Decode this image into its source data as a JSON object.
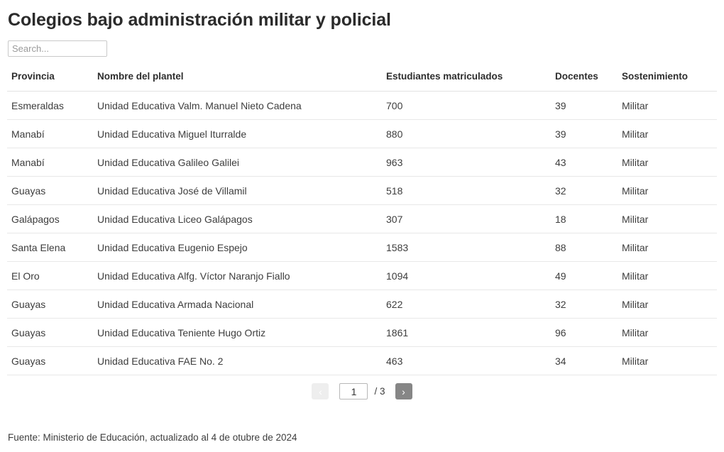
{
  "header": {
    "title": "Colegios bajo administración militar y policial"
  },
  "search": {
    "placeholder": "Search...",
    "value": ""
  },
  "table": {
    "columns": [
      "Provincia",
      "Nombre del plantel",
      "Estudiantes matriculados",
      "Docentes",
      "Sostenimiento"
    ],
    "rows": [
      [
        "Esmeraldas",
        "Unidad Educativa Valm. Manuel Nieto Cadena",
        "700",
        "39",
        "Militar"
      ],
      [
        "Manabí",
        "Unidad Educativa Miguel Iturralde",
        "880",
        "39",
        "Militar"
      ],
      [
        "Manabí",
        "Unidad Educativa Galileo Galilei",
        "963",
        "43",
        "Militar"
      ],
      [
        "Guayas",
        "Unidad Educativa José de Villamil",
        "518",
        "32",
        "Militar"
      ],
      [
        "Galápagos",
        "Unidad Educativa Liceo Galápagos",
        "307",
        "18",
        "Militar"
      ],
      [
        "Santa Elena",
        "Unidad Educativa Eugenio Espejo",
        "1583",
        "88",
        "Militar"
      ],
      [
        "El Oro",
        "Unidad Educativa Alfg. Víctor Naranjo Fiallo",
        "1094",
        "49",
        "Militar"
      ],
      [
        "Guayas",
        "Unidad Educativa Armada Nacional",
        "622",
        "32",
        "Militar"
      ],
      [
        "Guayas",
        "Unidad Educativa Teniente Hugo Ortiz",
        "1861",
        "96",
        "Militar"
      ],
      [
        "Guayas",
        "Unidad Educativa FAE No. 2",
        "463",
        "34",
        "Militar"
      ]
    ]
  },
  "pagination": {
    "prev_label": "‹",
    "next_label": "›",
    "current_page": "1",
    "total_pages_label": "/ 3",
    "total_pages": "3"
  },
  "footer": {
    "source": "Fuente: Ministerio de Educación, actualizado al 4 de otubre de 2024"
  },
  "colors": {
    "title": "#2b2b2b",
    "text": "#3d3d3d",
    "row_border": "#e8e8e8",
    "header_border": "#e2e2e2",
    "next_button_bg": "#868686",
    "prev_button_bg": "#eeeeee",
    "input_border": "#c9c9c9"
  }
}
